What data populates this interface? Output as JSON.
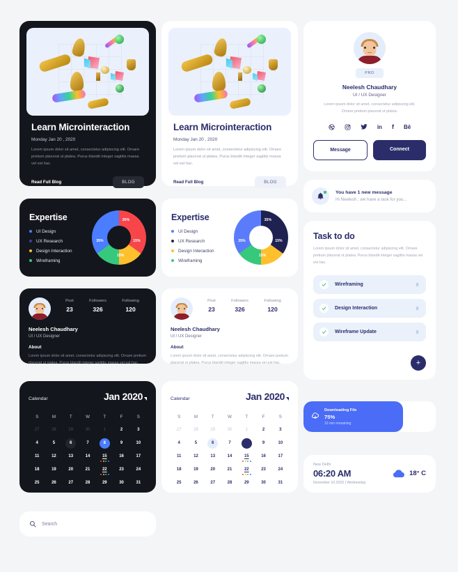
{
  "colors": {
    "page_bg": "#f4f5f7",
    "dark_card": "#14161d",
    "navy": "#2b2d6b",
    "blue": "#4a6cf7",
    "cal_blue": "#4a7dff",
    "soft_blue_bg": "#eaf1fb",
    "green": "#36c97b",
    "red": "#f8454a",
    "yellow": "#ffc02e"
  },
  "blog_dark": {
    "title": "Learn Microinteraction",
    "date": "Monday Jan 20 , 2020",
    "desc": "Lorem ipsum dolor sit amet, consectetur adipiscing elit. Ornare pretium placerat ut platea. Purus blandit integer sagittis massa vel est hac.",
    "link_label": "Read Full Blog",
    "tag_label": "BLOG"
  },
  "blog_light": {
    "title": "Learn Microinteraction",
    "date": "Monday Jan 20 , 2020",
    "desc": "Lorem ipsum dolor sit amet, consectetur adipiscing elit. Ornare pretium placerat ut platea. Purus blandit integer sagittis massa vel est hac.",
    "link_label": "Read Full Blog",
    "tag_label": "BLOG"
  },
  "profile": {
    "badge": "PRO",
    "name": "Neelesh Chaudhary",
    "role": "UI / UX Designer",
    "desc": "Lorem ipsum dolor sit amet, consectetur adipiscing elit. Ornare pretium placerat ut platea.",
    "socials": [
      {
        "name": "dribbble-icon",
        "glyph": "⚽"
      },
      {
        "name": "instagram-icon",
        "glyph": "▣"
      },
      {
        "name": "twitter-icon",
        "glyph": "🐦"
      },
      {
        "name": "linkedin-icon",
        "glyph": "in"
      },
      {
        "name": "facebook-icon",
        "glyph": "f"
      },
      {
        "name": "behance-icon",
        "glyph": "Bē"
      }
    ],
    "message_label": "Message",
    "connect_label": "Connect"
  },
  "expertise_dark": {
    "title": "Expertise",
    "legend": [
      {
        "label": "UI Design",
        "color": "#4a7dff"
      },
      {
        "label": "UX Research",
        "color": "#3b3fa0"
      },
      {
        "label": "Design Interaction",
        "color": "#ffc02e"
      },
      {
        "label": "Wireframing",
        "color": "#36c97b"
      }
    ]
  },
  "expertise_light": {
    "title": "Expertise",
    "legend": [
      {
        "label": "UI Design",
        "color": "#5b7cfa"
      },
      {
        "label": "UX Research",
        "color": "#1f2250"
      },
      {
        "label": "Design Interaction",
        "color": "#ffc02e"
      },
      {
        "label": "Wireframing",
        "color": "#36c97b"
      }
    ]
  },
  "chart_data": [
    {
      "type": "pie",
      "title": "Expertise",
      "variant": "dark",
      "categories": [
        "UI Design",
        "UX Research",
        "Design Interaction",
        "Wireframing"
      ],
      "values": [
        35,
        35,
        15,
        15
      ],
      "value_labels": [
        "35%",
        "35%",
        "15%",
        "15%"
      ],
      "colors": [
        "#4a7dff",
        "#f8454a",
        "#ffc02e",
        "#36c97b"
      ],
      "legend_position": "left",
      "donut": true
    },
    {
      "type": "pie",
      "title": "Expertise",
      "variant": "light",
      "categories": [
        "UI Design",
        "UX Research",
        "Design Interaction",
        "Wireframing"
      ],
      "values": [
        35,
        35,
        15,
        15
      ],
      "value_labels": [
        "35%",
        "35%",
        "15%",
        "15%"
      ],
      "colors": [
        "#5b7cfa",
        "#1f2250",
        "#ffc02e",
        "#36c97b"
      ],
      "legend_position": "left",
      "donut": true
    }
  ],
  "stats_dark": {
    "items": [
      {
        "key": "Post",
        "value": "23"
      },
      {
        "key": "Followers",
        "value": "326"
      },
      {
        "key": "Following",
        "value": "120"
      }
    ],
    "name": "Neelesh Chaudhary",
    "role": "UI / UX Designer",
    "about_label": "About",
    "about_text": "Lorem ipsum dolor sit amet, consectetur adipiscing elit. Ornare pretium placerat ut platea. Purus blandit integer sagittis massa vel est hac."
  },
  "stats_light": {
    "items": [
      {
        "key": "Post",
        "value": "23"
      },
      {
        "key": "Followers",
        "value": "326"
      },
      {
        "key": "Following",
        "value": "120"
      }
    ],
    "name": "Neelesh Chaudhary",
    "role": "UI / UX Designer",
    "about_label": "About",
    "about_text": "Lorem ipsum dolor sit amet, consectetur adipiscing elit. Ornare pretium placerat ut platea. Purus blandit integer sagittis massa vel est hac."
  },
  "message": {
    "title": "You have 1 new message",
    "subtitle": "Hi Neelesh , we have a task for you..."
  },
  "tasks": {
    "title": "Task to do",
    "desc": "Lorem ipsum dolor sit amet, consectetur adipiscing elit. Ornare pretium placerat ut platea. Purus blandit integer sagittis massa vel est hac.",
    "items": [
      {
        "label": "Wireframing",
        "done": true
      },
      {
        "label": "Design Interaction",
        "done": true
      },
      {
        "label": "Wireframe Update",
        "done": true
      }
    ],
    "add_label": "+"
  },
  "calendar": {
    "label": "Calendar",
    "month": "Jan 2020",
    "dow": [
      "S",
      "M",
      "T",
      "W",
      "T",
      "F",
      "S"
    ],
    "weeks": [
      [
        {
          "n": "27",
          "muted": true
        },
        {
          "n": "28",
          "muted": true
        },
        {
          "n": "29",
          "muted": true
        },
        {
          "n": "30",
          "muted": true
        },
        {
          "n": "1",
          "muted": true
        },
        {
          "n": "2"
        },
        {
          "n": "3"
        }
      ],
      [
        {
          "n": "4"
        },
        {
          "n": "5"
        },
        {
          "n": "6",
          "soft": true
        },
        {
          "n": "7"
        },
        {
          "n": "8",
          "selected": true
        },
        {
          "n": "9"
        },
        {
          "n": "10"
        }
      ],
      [
        {
          "n": "11"
        },
        {
          "n": "12"
        },
        {
          "n": "13"
        },
        {
          "n": "14"
        },
        {
          "n": "15",
          "events": [
            "#f8454a",
            "#ffc02e",
            "#36c97b",
            "#4a7dff"
          ]
        },
        {
          "n": "16"
        },
        {
          "n": "17"
        }
      ],
      [
        {
          "n": "18"
        },
        {
          "n": "19"
        },
        {
          "n": "20"
        },
        {
          "n": "21"
        },
        {
          "n": "22",
          "events": [
            "#f8454a",
            "#ffc02e",
            "#36c97b",
            "#4a7dff"
          ]
        },
        {
          "n": "23"
        },
        {
          "n": "24"
        }
      ],
      [
        {
          "n": "25"
        },
        {
          "n": "26"
        },
        {
          "n": "27"
        },
        {
          "n": "28"
        },
        {
          "n": "29"
        },
        {
          "n": "30"
        },
        {
          "n": "31"
        }
      ]
    ]
  },
  "download": {
    "title": "Downloading File",
    "percent_label": "75%",
    "percent": 75,
    "remaining": "10 min remaining"
  },
  "weather": {
    "city": "New Delhi",
    "time": "06:20 AM",
    "date": "November 10.2020 | Wednesday",
    "temperature": "18° C",
    "icon": "cloud-icon"
  },
  "search": {
    "placeholder": "Search",
    "icon": "search-icon"
  }
}
